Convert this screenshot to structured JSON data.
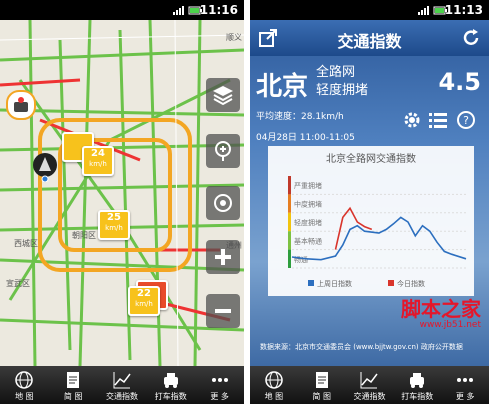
{
  "left_phone": {
    "status": {
      "time": "11:16"
    },
    "map": {
      "labels": [
        "西城区",
        "朝阳区",
        "宣武区",
        "顺义",
        "通州"
      ],
      "speeds": [
        {
          "value": "24",
          "unit": "km/h"
        },
        {
          "value": "25",
          "unit": "km/h"
        },
        {
          "value": "22",
          "unit": "km/h"
        }
      ]
    },
    "tabs": [
      {
        "label": "地 图",
        "icon": "globe-icon"
      },
      {
        "label": "简 图",
        "icon": "document-icon"
      },
      {
        "label": "交通指数",
        "icon": "chart-icon"
      },
      {
        "label": "打车指数",
        "icon": "taxi-icon"
      },
      {
        "label": "更 多",
        "icon": "more-icon"
      }
    ]
  },
  "right_phone": {
    "status": {
      "time": "11:13"
    },
    "header": {
      "title": "交通指数"
    },
    "city": "北京",
    "scope_line1": "全路网",
    "scope_line2": "轻度拥堵",
    "index": "4.5",
    "avg_speed": "平均速度：28.1km/h",
    "date": "04月28日 11:00-11:05",
    "source": "数据来源：北京市交通委员会 (www.bjjtw.gov.cn) 政府公开数据",
    "watermark": "脚本之家",
    "watermark_url": "www.jb51.net",
    "tabs": [
      {
        "label": "地 图"
      },
      {
        "label": "简 图"
      },
      {
        "label": "交通指数"
      },
      {
        "label": "打车指数"
      },
      {
        "label": "更 多"
      }
    ]
  },
  "chart_data": {
    "type": "line",
    "title": "北京全路网交通指数",
    "levels": [
      "严重拥堵",
      "中度拥堵",
      "轻度拥堵",
      "基本畅通",
      "畅通"
    ],
    "level_colors": [
      "#c0392b",
      "#e67e22",
      "#f1c40f",
      "#7dc242",
      "#2e9e3e"
    ],
    "ylim": [
      0,
      10
    ],
    "series": [
      {
        "name": "上周日指数",
        "color": "#2c6fbf",
        "points": [
          [
            0,
            1.2
          ],
          [
            2,
            1.0
          ],
          [
            4,
            0.9
          ],
          [
            6,
            1.3
          ],
          [
            7,
            2.5
          ],
          [
            8,
            4.2
          ],
          [
            9,
            4.6
          ],
          [
            10,
            4.0
          ],
          [
            12,
            3.8
          ],
          [
            13,
            4.2
          ],
          [
            14,
            4.8
          ],
          [
            15,
            5.5
          ],
          [
            16,
            5.0
          ],
          [
            17,
            3.5
          ],
          [
            18,
            4.6
          ],
          [
            19,
            4.0
          ],
          [
            20,
            2.8
          ],
          [
            21,
            1.8
          ],
          [
            22,
            1.5
          ],
          [
            24,
            1.0
          ]
        ]
      },
      {
        "name": "今日指数",
        "color": "#d9352c",
        "points": [
          [
            6,
            2.0
          ],
          [
            7,
            5.5
          ],
          [
            8,
            6.5
          ],
          [
            9,
            5.0
          ],
          [
            10,
            4.5
          ],
          [
            11,
            4.2
          ]
        ]
      }
    ]
  }
}
